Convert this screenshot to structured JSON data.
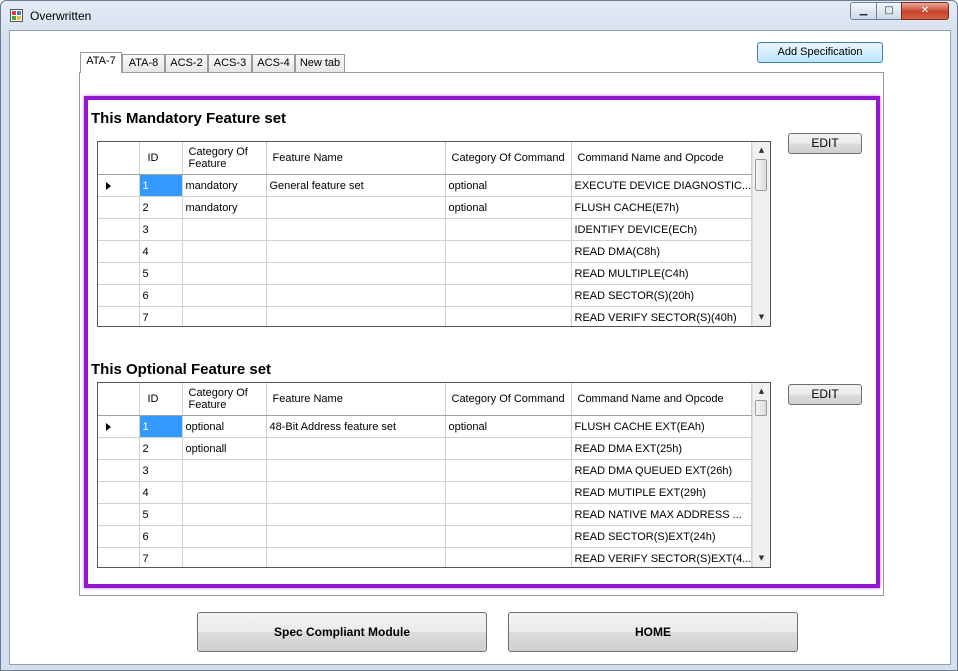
{
  "window": {
    "title": "Overwritten",
    "min_icon": "minimize-icon",
    "max_icon": "maximize-icon",
    "close_icon": "close-icon"
  },
  "toolbar": {
    "add_spec_label": "Add Specification"
  },
  "tabs": [
    {
      "label": "ATA-7",
      "active": true
    },
    {
      "label": "ATA-8"
    },
    {
      "label": "ACS-2"
    },
    {
      "label": "ACS-3"
    },
    {
      "label": "ACS-4"
    },
    {
      "label": "New tab"
    }
  ],
  "mandatory": {
    "title": "This Mandatory Feature set",
    "edit_label": "EDIT",
    "columns": {
      "id": "ID",
      "cat_feature": "Category Of Feature",
      "feature_name": "Feature Name",
      "cat_command": "Category Of Command",
      "command": "Command Name and Opcode"
    },
    "rows": [
      {
        "id": "1",
        "cat_feature": "mandatory",
        "feature_name": "General feature set",
        "cat_command": "optional",
        "command": "EXECUTE DEVICE DIAGNOSTIC..."
      },
      {
        "id": "2",
        "cat_feature": "mandatory",
        "feature_name": "",
        "cat_command": "optional",
        "command": "FLUSH CACHE(E7h)"
      },
      {
        "id": "3",
        "cat_feature": "",
        "feature_name": "",
        "cat_command": "",
        "command": "IDENTIFY DEVICE(ECh)"
      },
      {
        "id": "4",
        "cat_feature": "",
        "feature_name": "",
        "cat_command": "",
        "command": "READ DMA(C8h)"
      },
      {
        "id": "5",
        "cat_feature": "",
        "feature_name": "",
        "cat_command": "",
        "command": "READ MULTIPLE(C4h)"
      },
      {
        "id": "6",
        "cat_feature": "",
        "feature_name": "",
        "cat_command": "",
        "command": "READ SECTOR(S)(20h)"
      },
      {
        "id": "7",
        "cat_feature": "",
        "feature_name": "",
        "cat_command": "",
        "command": "READ VERIFY SECTOR(S)(40h)"
      }
    ]
  },
  "optional": {
    "title": "This Optional Feature set",
    "edit_label": "EDIT",
    "columns": {
      "id": "ID",
      "cat_feature": "Category Of Feature",
      "feature_name": "Feature Name",
      "cat_command": "Category Of Command",
      "command": "Command Name and Opcode"
    },
    "rows": [
      {
        "id": "1",
        "cat_feature": "optional",
        "feature_name": "48-Bit Address feature set",
        "cat_command": "optional",
        "command": "FLUSH CACHE EXT(EAh)"
      },
      {
        "id": "2",
        "cat_feature": "optionall",
        "feature_name": "",
        "cat_command": "",
        "command": "READ DMA EXT(25h)"
      },
      {
        "id": "3",
        "cat_feature": "",
        "feature_name": "",
        "cat_command": "",
        "command": "READ DMA QUEUED EXT(26h)"
      },
      {
        "id": "4",
        "cat_feature": "",
        "feature_name": "",
        "cat_command": "",
        "command": "READ MUTIPLE EXT(29h)"
      },
      {
        "id": "5",
        "cat_feature": "",
        "feature_name": "",
        "cat_command": "",
        "command": "READ NATIVE MAX ADDRESS ..."
      },
      {
        "id": "6",
        "cat_feature": "",
        "feature_name": "",
        "cat_command": "",
        "command": "READ SECTOR(S)EXT(24h)"
      },
      {
        "id": "7",
        "cat_feature": "",
        "feature_name": "",
        "cat_command": "",
        "command": "READ VERIFY SECTOR(S)EXT(4..."
      }
    ]
  },
  "bottom": {
    "spec_module_label": "Spec Compliant Module",
    "home_label": "HOME"
  },
  "colors": {
    "highlight": "#9317d1",
    "selection": "#3399ff"
  }
}
